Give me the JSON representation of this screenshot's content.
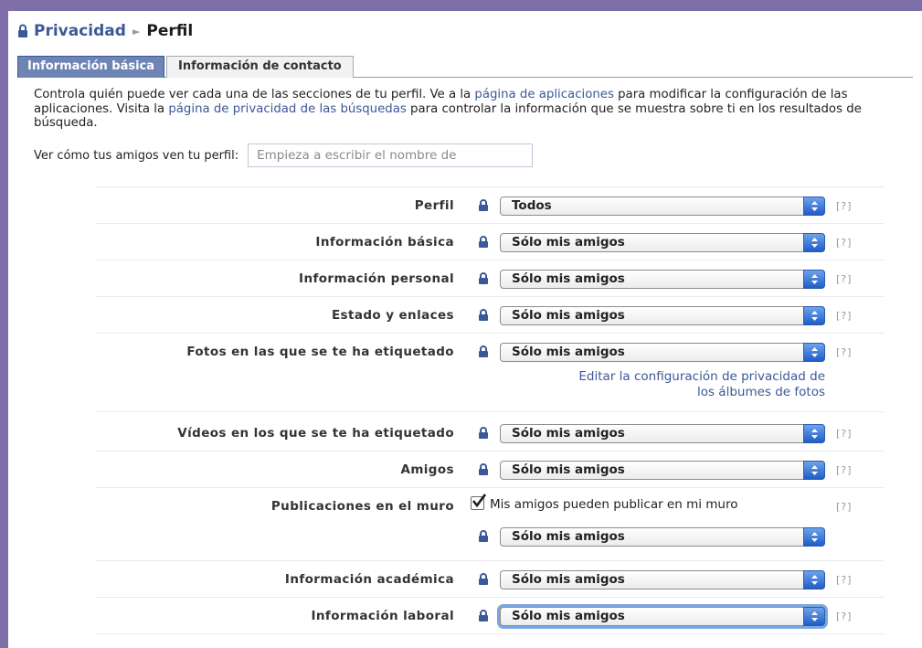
{
  "breadcrumb": {
    "parent": "Privacidad",
    "separator": "►",
    "current": "Perfil"
  },
  "tabs": [
    {
      "label": "Información básica",
      "active": true
    },
    {
      "label": "Información de contacto",
      "active": false
    }
  ],
  "intro": {
    "t1": "Controla quién puede ver cada una de las secciones de tu perfil. Ve a la ",
    "link1": "página de aplicaciones",
    "t2": " para modificar la configuración de las aplicaciones. Visita la ",
    "link2": "página de privacidad de las búsquedas",
    "t3": " para controlar la información que se muestra sobre ti en los resultados de búsqueda."
  },
  "preview": {
    "label": "Ver cómo tus amigos ven tu perfil:",
    "placeholder": "Empieza a escribir el nombre de"
  },
  "help_label": "[?]",
  "settings": [
    {
      "label": "Perfil",
      "value": "Todos"
    },
    {
      "label": "Información básica",
      "value": "Sólo mis amigos"
    },
    {
      "label": "Información personal",
      "value": "Sólo mis amigos"
    },
    {
      "label": "Estado y enlaces",
      "value": "Sólo mis amigos"
    },
    {
      "label": "Fotos en las que se te ha etiquetado",
      "value": "Sólo mis amigos",
      "link_line1": "Editar la configuración de privacidad de",
      "link_line2": "los álbumes de fotos"
    },
    {
      "label": "Vídeos en los que se te ha etiquetado",
      "value": "Sólo mis amigos"
    },
    {
      "label": "Amigos",
      "value": "Sólo mis amigos"
    },
    {
      "label": "Publicaciones en el muro",
      "value": "Sólo mis amigos",
      "checkbox_label": "Mis amigos pueden publicar en mi muro",
      "checked": true
    },
    {
      "label": "Información académica",
      "value": "Sólo mis amigos"
    },
    {
      "label": "Información laboral",
      "value": "Sólo mis amigos"
    }
  ],
  "colors": {
    "brand": "#3b5998",
    "tab_active": "#6d84b4",
    "frame": "#7f6fa8",
    "select_arrow": "#1f5dc8"
  }
}
